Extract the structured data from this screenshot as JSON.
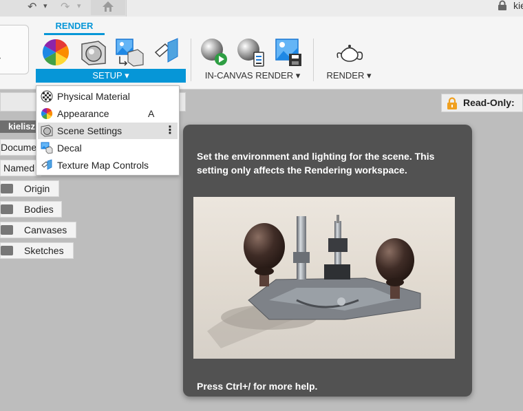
{
  "topbar": {
    "undo_symbol": "↶",
    "redo_symbol": "↷",
    "caret": "▾",
    "user_name": "kie"
  },
  "ribbon": {
    "active_tab": "RENDER",
    "groups": {
      "setup": "SETUP ▾",
      "in_canvas_render": "IN-CANVAS RENDER ▾",
      "render": "RENDER ▾"
    },
    "tools": [
      {
        "name": "appearance-tool",
        "icon": "color-wheel-icon"
      },
      {
        "name": "scene-settings-tool",
        "icon": "scene-settings-icon"
      },
      {
        "name": "decal-tool",
        "icon": "decal-icon"
      },
      {
        "name": "texture-map-tool",
        "icon": "texture-map-icon"
      },
      {
        "name": "in-canvas-render-tool",
        "icon": "sphere-play-icon"
      },
      {
        "name": "in-canvas-render-settings-tool",
        "icon": "sphere-settings-icon"
      },
      {
        "name": "capture-image-tool",
        "icon": "capture-image-icon"
      },
      {
        "name": "render-tool",
        "icon": "teapot-icon"
      }
    ],
    "workspace_caret": "▾"
  },
  "browser": {
    "title": "kielisz",
    "rows": [
      "Docume",
      "Named"
    ],
    "folders": [
      "Origin",
      "Bodies",
      "Canvases",
      "Sketches"
    ]
  },
  "setup_menu": {
    "items": [
      {
        "label": "Physical Material",
        "icon": "checker-sphere-icon",
        "shortcut": ""
      },
      {
        "label": "Appearance",
        "icon": "color-wheel-icon",
        "shortcut": "A"
      },
      {
        "label": "Scene Settings",
        "icon": "scene-settings-icon",
        "shortcut": "",
        "more": "⋮"
      },
      {
        "label": "Decal",
        "icon": "decal-icon",
        "shortcut": ""
      },
      {
        "label": "Texture Map Controls",
        "icon": "texture-map-icon",
        "shortcut": ""
      }
    ]
  },
  "readonly": {
    "label": "Read-Only:"
  },
  "tooltip": {
    "description": "Set the environment and lighting for the scene. This setting only affects the Rendering workspace.",
    "help": "Press Ctrl+/ for more help."
  },
  "colors": {
    "accent": "#0696d7",
    "tooltip_bg": "#525252",
    "canvas_bg": "#bdbdbd"
  }
}
